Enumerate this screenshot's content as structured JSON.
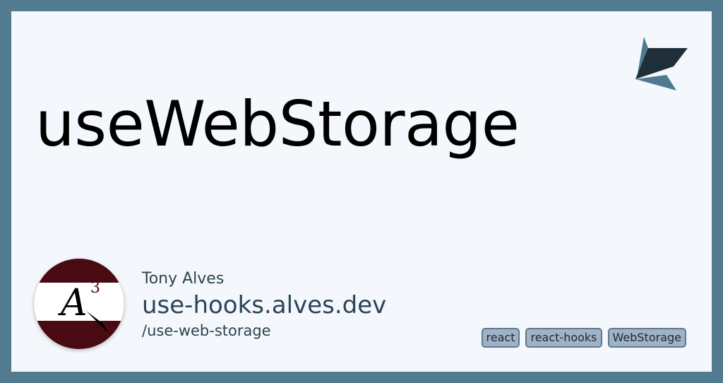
{
  "card": {
    "title": "useWebStorage",
    "author": "Tony Alves",
    "site": "use-hooks.alves.dev",
    "path": "/use-web-storage",
    "tags": [
      "react",
      "react-hooks",
      "WebStorage"
    ]
  },
  "avatar": {
    "letter": "A",
    "superscript": "3"
  },
  "colors": {
    "border": "#527b8f",
    "card_bg": "#f4f8fc",
    "avatar_maroon": "#4a0a12",
    "tag_bg": "#9fb2c7",
    "tag_border": "#5f7a90"
  },
  "icons": {
    "brand_logo": "paper-plane-logo-icon"
  }
}
